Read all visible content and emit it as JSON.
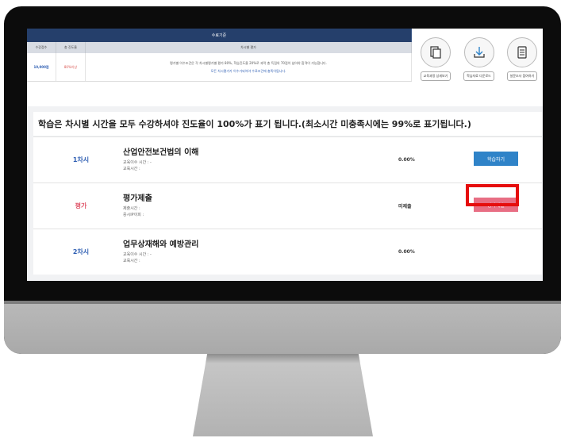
{
  "criteria": {
    "header": "수료기준",
    "columns": [
      "수강점수",
      "총 진도율",
      "차시별 평가"
    ],
    "score": "10,000점",
    "progress": "80%이상",
    "desc_line1": "평가별 이수조건은 각 차시별평가별 평가 80%, 학습진도율 20%로 과락 총 득점의 70점이 넘어야 합격이 가능합니다.",
    "desc_line2": "모든 차시평가가 이수가되어야 수료조건에 충족이됩니다."
  },
  "tools": [
    {
      "icon": "document-icon",
      "label": "교육과정 상세보기"
    },
    {
      "icon": "download-icon",
      "label": "학습자료 다운로드"
    },
    {
      "icon": "checklist-icon",
      "label": "설문조사 참여하기"
    }
  ],
  "notice": "학습은 차시별 시간을 모두 수강하셔야 진도율이 100%가 표기 됩니다.(최소시간 미충족시에는 99%로 표기됩니다.)",
  "rows": [
    {
      "num": "1차시",
      "title": "산업안전보건법의 이해",
      "meta1": "교육이수 시간 : -",
      "meta2": "교육시간 :",
      "stat": "0.00%",
      "action": "학습하기"
    },
    {
      "num": "평가",
      "title": "평가제출",
      "meta1": "제출시간 :",
      "meta2": "응시IP이피 :",
      "stat": "미제출",
      "action": "평가제출"
    },
    {
      "num": "2차시",
      "title": "업무상재해와 예방관리",
      "meta1": "교육이수 시간 : -",
      "meta2": "교육시간 :",
      "stat": "0.00%",
      "action": ""
    }
  ],
  "colors": {
    "header": "#253f6b",
    "study": "#2f83c8",
    "eval": "#e86e84",
    "highlight": "#e60d0d"
  }
}
